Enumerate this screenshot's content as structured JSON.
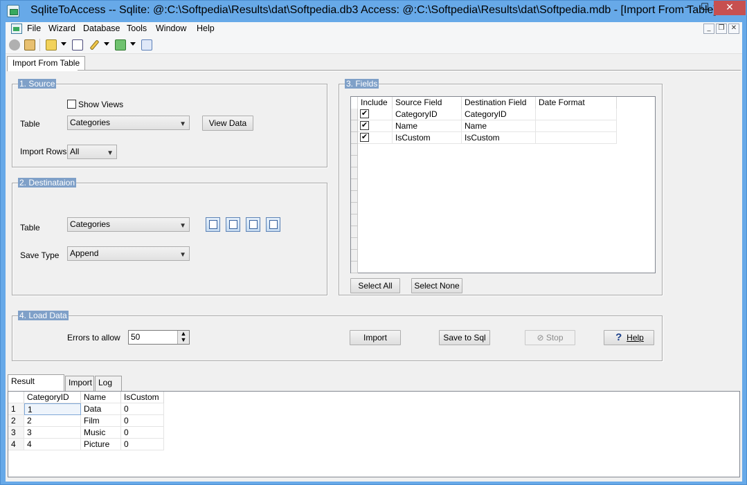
{
  "window": {
    "title": "SqliteToAccess -- Sqlite: @:C:\\Softpedia\\Results\\dat\\Softpedia.db3 Access: @:C:\\Softpedia\\Results\\dat\\Softpedia.mdb - [Import From Table]"
  },
  "menu": {
    "items": [
      "File",
      "Wizard",
      "Database",
      "Tools",
      "Window",
      "Help"
    ]
  },
  "document_tab": {
    "label": "Import From Table"
  },
  "source": {
    "title": "1. Source",
    "show_views_label": "Show Views",
    "show_views_checked": false,
    "table_label": "Table",
    "table_value": "Categories",
    "view_data_label": "View Data",
    "import_rows_label": "Import Rows",
    "import_rows_value": "All"
  },
  "destination": {
    "title": "2. Destinataion",
    "table_label": "Table",
    "table_value": "Categories",
    "save_type_label": "Save Type",
    "save_type_value": "Append"
  },
  "fields": {
    "title": "3. Fields",
    "columns": [
      "Include",
      "Source Field",
      "Destination Field",
      "Date Format"
    ],
    "rows": [
      {
        "include": true,
        "source": "CategoryID",
        "destination": "CategoryID",
        "date_format": ""
      },
      {
        "include": true,
        "source": "Name",
        "destination": "Name",
        "date_format": ""
      },
      {
        "include": true,
        "source": "IsCustom",
        "destination": "IsCustom",
        "date_format": ""
      }
    ],
    "select_all_label": "Select All",
    "select_none_label": "Select None"
  },
  "load": {
    "title": "4. Load Data",
    "errors_label": "Errors to allow",
    "errors_value": "50",
    "import_label": "Import",
    "save_sql_label": "Save to Sql",
    "stop_label": "Stop",
    "help_label": "Help"
  },
  "bottom_tabs": [
    "Result Preview",
    "Import",
    "Log"
  ],
  "preview": {
    "columns": [
      "CategoryID",
      "Name",
      "IsCustom"
    ],
    "rows": [
      {
        "num": "1",
        "values": [
          "1",
          "Data",
          "0"
        ]
      },
      {
        "num": "2",
        "values": [
          "2",
          "Film",
          "0"
        ]
      },
      {
        "num": "3",
        "values": [
          "3",
          "Music",
          "0"
        ]
      },
      {
        "num": "4",
        "values": [
          "4",
          "Picture",
          "0"
        ]
      }
    ]
  },
  "colors": {
    "titlebar": "#67a9e8",
    "group_title": "#7fa0c8",
    "close_button": "#c75050"
  }
}
